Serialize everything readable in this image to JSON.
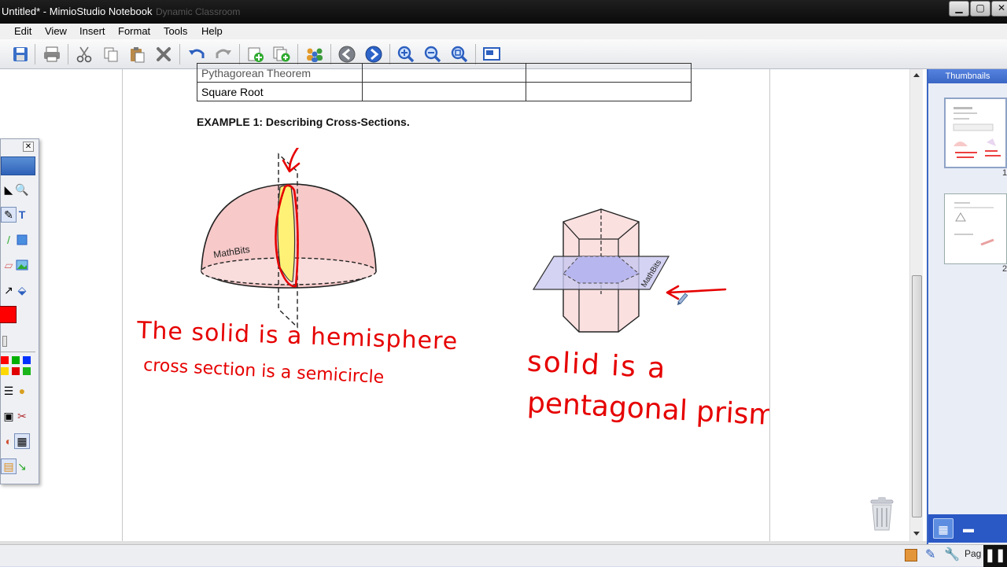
{
  "window": {
    "title": "Untitled* - MimioStudio Notebook",
    "background_tab": "Dynamic Classroom",
    "controls": {
      "minimize": "▁",
      "maximize": "▢",
      "close": "✕"
    }
  },
  "menu": [
    "Edit",
    "View",
    "Insert",
    "Format",
    "Tools",
    "Help"
  ],
  "toolbar": {
    "icons": [
      "save-icon",
      "print-icon",
      "cut-icon",
      "copy-icon",
      "paste-icon",
      "delete-icon",
      "undo-icon",
      "redo-icon",
      "new-page-icon",
      "duplicate-page-icon",
      "users-icon",
      "previous-page-icon",
      "next-page-icon",
      "zoom-in-icon",
      "zoom-out-icon",
      "zoom-fit-icon",
      "screen-icon"
    ]
  },
  "document": {
    "table_rows": [
      [
        "Pythagorean Theorem",
        "",
        ""
      ],
      [
        "Square Root",
        "",
        ""
      ]
    ],
    "example_heading": "EXAMPLE 1: Describing Cross-Sections.",
    "hemisphere_label": "MathBits",
    "prism_label": "MathBits",
    "ink_note_left_line1": "The solid is a hemisphere",
    "ink_note_left_line2": "cross section is a semicircle",
    "ink_note_right_line1": "solid is a",
    "ink_note_right_line2": "pentagonal prism"
  },
  "thumbnails": {
    "header": "Thumbnails",
    "page_numbers": [
      "1",
      "2"
    ]
  },
  "status": {
    "label": "Pag"
  },
  "colors": {
    "ink": "#e60000",
    "titlebar": "#111111",
    "panel_accent": "#3b66c4",
    "hemisphere_fill": "#f7c9c9",
    "cross_section_fill": "#fff176",
    "prism_plane_fill": "#c9c8f0"
  },
  "palette": {
    "swatches": [
      "#ff0000",
      "#00b000",
      "#0030ff",
      "#ffd800",
      "#e00000",
      "#1ab51a",
      "#1846ff",
      "#f0c000"
    ]
  }
}
